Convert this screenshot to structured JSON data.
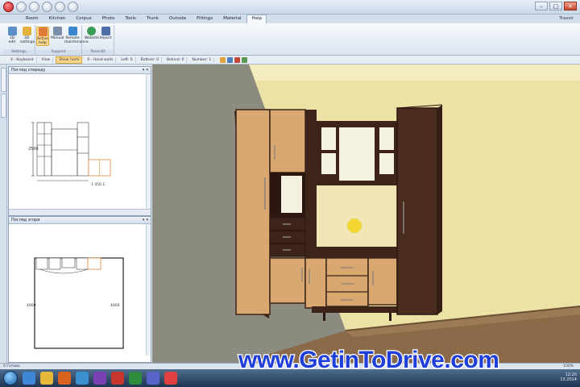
{
  "window": {
    "title": "",
    "controls": [
      "minimize",
      "maximize",
      "close"
    ]
  },
  "ribbon": {
    "tabs": [
      "Room",
      "Kitchen",
      "Corpus",
      "Photo",
      "Tools",
      "Trunk",
      "Outside",
      "Fittings",
      "Material",
      "Help"
    ],
    "active_tab": "Help",
    "right_tag": "Trassir",
    "groups": [
      {
        "name": "Settings",
        "buttons": [
          "3D edit",
          "3D settings"
        ]
      },
      {
        "name": "Support",
        "buttons": [
          "Active help",
          "Manual",
          "Remote maintenance"
        ]
      },
      {
        "name": "Team3D",
        "buttons": [
          "Website",
          "Import"
        ]
      }
    ]
  },
  "toolbar": {
    "items": [
      "4 - Keyboard",
      "View",
      "Show room",
      "0 - Hand walls",
      "Left: 0",
      "Bottom: 0",
      "Behind: 0",
      "Number: 1"
    ]
  },
  "panels": {
    "top": {
      "title": "Погляд спереду",
      "dimension_height": "2500",
      "dimension_width": "1 450.1"
    },
    "bottom": {
      "title": "Погляд згори",
      "dimension_left": "4000",
      "dimension_right": "4000"
    }
  },
  "statusbar": {
    "left": "0 Готово",
    "right": "100%"
  },
  "taskbar": {
    "tray_time": "12:20",
    "tray_date": "13.2014"
  },
  "watermark": {
    "text": "www.GetinToDrive.com"
  },
  "colors": {
    "wall_left": "#8c8b80",
    "wall_back": "#ede3a8",
    "floor": "#8a6a48",
    "cabinet_light": "#d8a870",
    "cabinet_dark": "#3e2418",
    "watermark": "#1f3fd8",
    "active_button": "#fbd88c"
  }
}
